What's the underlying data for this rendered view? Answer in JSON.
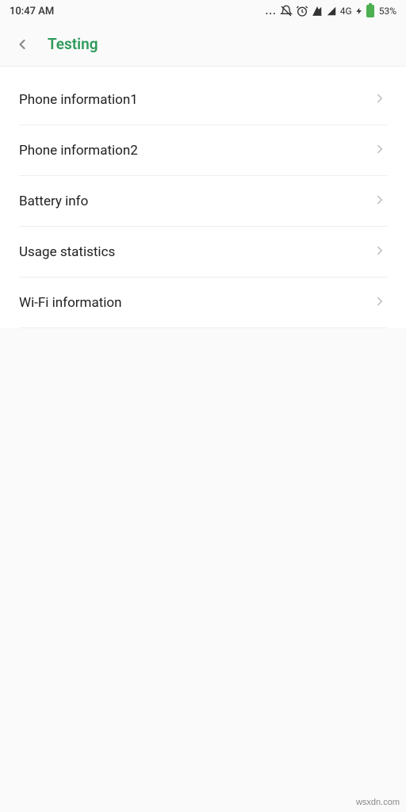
{
  "statusBar": {
    "time": "10:47 AM",
    "dots": "...",
    "networkLabel": "4G",
    "batteryPercent": "53%"
  },
  "header": {
    "title": "Testing"
  },
  "menu": {
    "items": [
      {
        "label": "Phone information1"
      },
      {
        "label": "Phone information2"
      },
      {
        "label": "Battery info"
      },
      {
        "label": "Usage statistics"
      },
      {
        "label": "Wi-Fi information"
      }
    ]
  },
  "watermark": "wsxdn.com"
}
